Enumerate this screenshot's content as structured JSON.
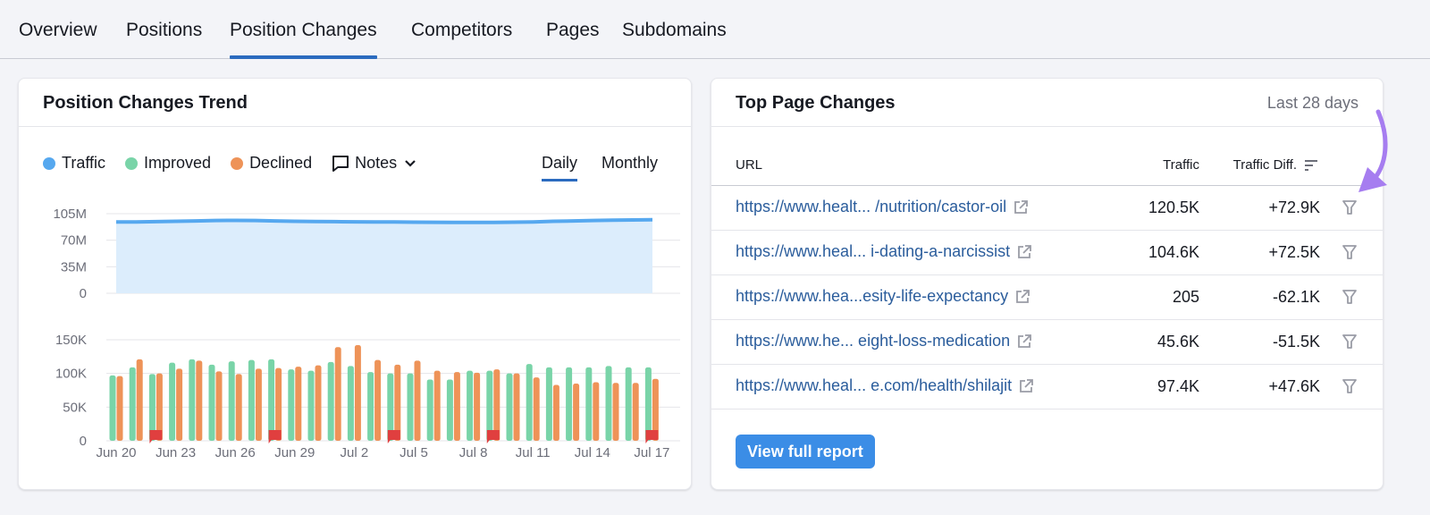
{
  "tabs": [
    {
      "label": "Overview",
      "active": false
    },
    {
      "label": "Positions",
      "active": false
    },
    {
      "label": "Position Changes",
      "active": true
    },
    {
      "label": "Competitors",
      "active": false
    },
    {
      "label": "Pages",
      "active": false
    },
    {
      "label": "Subdomains",
      "active": false
    }
  ],
  "trend_card": {
    "title": "Position Changes Trend",
    "legend": [
      {
        "label": "Traffic",
        "color": "#56a8ef"
      },
      {
        "label": "Improved",
        "color": "#79d4a8"
      },
      {
        "label": "Declined",
        "color": "#ee9358"
      }
    ],
    "notes_label": "Notes",
    "periods": [
      {
        "label": "Daily",
        "active": true
      },
      {
        "label": "Monthly",
        "active": false
      }
    ]
  },
  "chart_data": [
    {
      "type": "area",
      "title": "Traffic",
      "ylim": [
        0,
        105000000
      ],
      "yticks": [
        "105M",
        "70M",
        "35M",
        "0"
      ],
      "yticks_values": [
        105000000,
        70000000,
        35000000,
        0
      ],
      "line_color": "#56a8ef",
      "fill_color": "#dcedfc",
      "values": [
        94,
        94,
        94.5,
        95,
        95.5,
        96,
        96.2,
        96,
        95.5,
        95,
        94.6,
        94.5,
        94.3,
        94.2,
        94,
        93.8,
        93.7,
        93.6,
        93.5,
        93.5,
        93.8,
        94.2,
        95,
        95.5,
        96,
        96.5,
        96.8,
        97
      ],
      "value_unit": "M"
    },
    {
      "type": "bar",
      "title": "Position changes",
      "ylim": [
        0,
        150000
      ],
      "yticks": [
        "150K",
        "100K",
        "50K",
        "0"
      ],
      "yticks_values": [
        150000,
        100000,
        50000,
        0
      ],
      "categories": [
        "Jun 20",
        "Jun 21",
        "Jun 22",
        "Jun 23",
        "Jun 24",
        "Jun 25",
        "Jun 26",
        "Jun 27",
        "Jun 28",
        "Jun 29",
        "Jun 30",
        "Jul 1",
        "Jul 2",
        "Jul 3",
        "Jul 4",
        "Jul 5",
        "Jul 6",
        "Jul 7",
        "Jul 8",
        "Jul 9",
        "Jul 10",
        "Jul 11",
        "Jul 12",
        "Jul 13",
        "Jul 14",
        "Jul 15",
        "Jul 16",
        "Jul 17"
      ],
      "xtick_labels": [
        "Jun 20",
        "Jun 23",
        "Jun 26",
        "Jun 29",
        "Jul 2",
        "Jul 5",
        "Jul 8",
        "Jul 11",
        "Jul 14",
        "Jul 17"
      ],
      "series": [
        {
          "name": "Improved",
          "color": "#79d4a8",
          "values": [
            97,
            109,
            99,
            116,
            121,
            113,
            118,
            120,
            121,
            106,
            104,
            117,
            111,
            102,
            100,
            100,
            91,
            91,
            104,
            104,
            100,
            114,
            109,
            109,
            109,
            111,
            109,
            109
          ]
        },
        {
          "name": "Declined",
          "color": "#ee9358",
          "values": [
            96,
            121,
            100,
            107,
            119,
            103,
            99,
            107,
            108,
            110,
            112,
            139,
            142,
            120,
            113,
            119,
            104,
            102,
            101,
            106,
            100,
            94,
            83,
            85,
            87,
            86,
            86,
            92
          ]
        }
      ],
      "value_unit": "K",
      "notes_flags": [
        "Jun 22",
        "Jun 28",
        "Jul 4",
        "Jul 9",
        "Jul 17"
      ],
      "flag_color": "#e03f3f"
    }
  ],
  "top_pages": {
    "title": "Top Page Changes",
    "period": "Last 28 days",
    "columns": {
      "url": "URL",
      "traffic": "Traffic",
      "diff": "Traffic Diff."
    },
    "rows": [
      {
        "url": "https://www.healt... /nutrition/castor-oil",
        "traffic": "120.5K",
        "diff": "+72.9K"
      },
      {
        "url": "https://www.heal... i-dating-a-narcissist",
        "traffic": "104.6K",
        "diff": "+72.5K"
      },
      {
        "url": "https://www.hea...esity-life-expectancy",
        "traffic": "205",
        "diff": "-62.1K"
      },
      {
        "url": "https://www.he... eight-loss-medication",
        "traffic": "45.6K",
        "diff": "-51.5K"
      },
      {
        "url": "https://www.heal... e.com/health/shilajit",
        "traffic": "97.4K",
        "diff": "+47.6K"
      }
    ],
    "button_label": "View full report",
    "button_color": "#3b8de6",
    "annotation_arrow_color": "#a67df0"
  }
}
